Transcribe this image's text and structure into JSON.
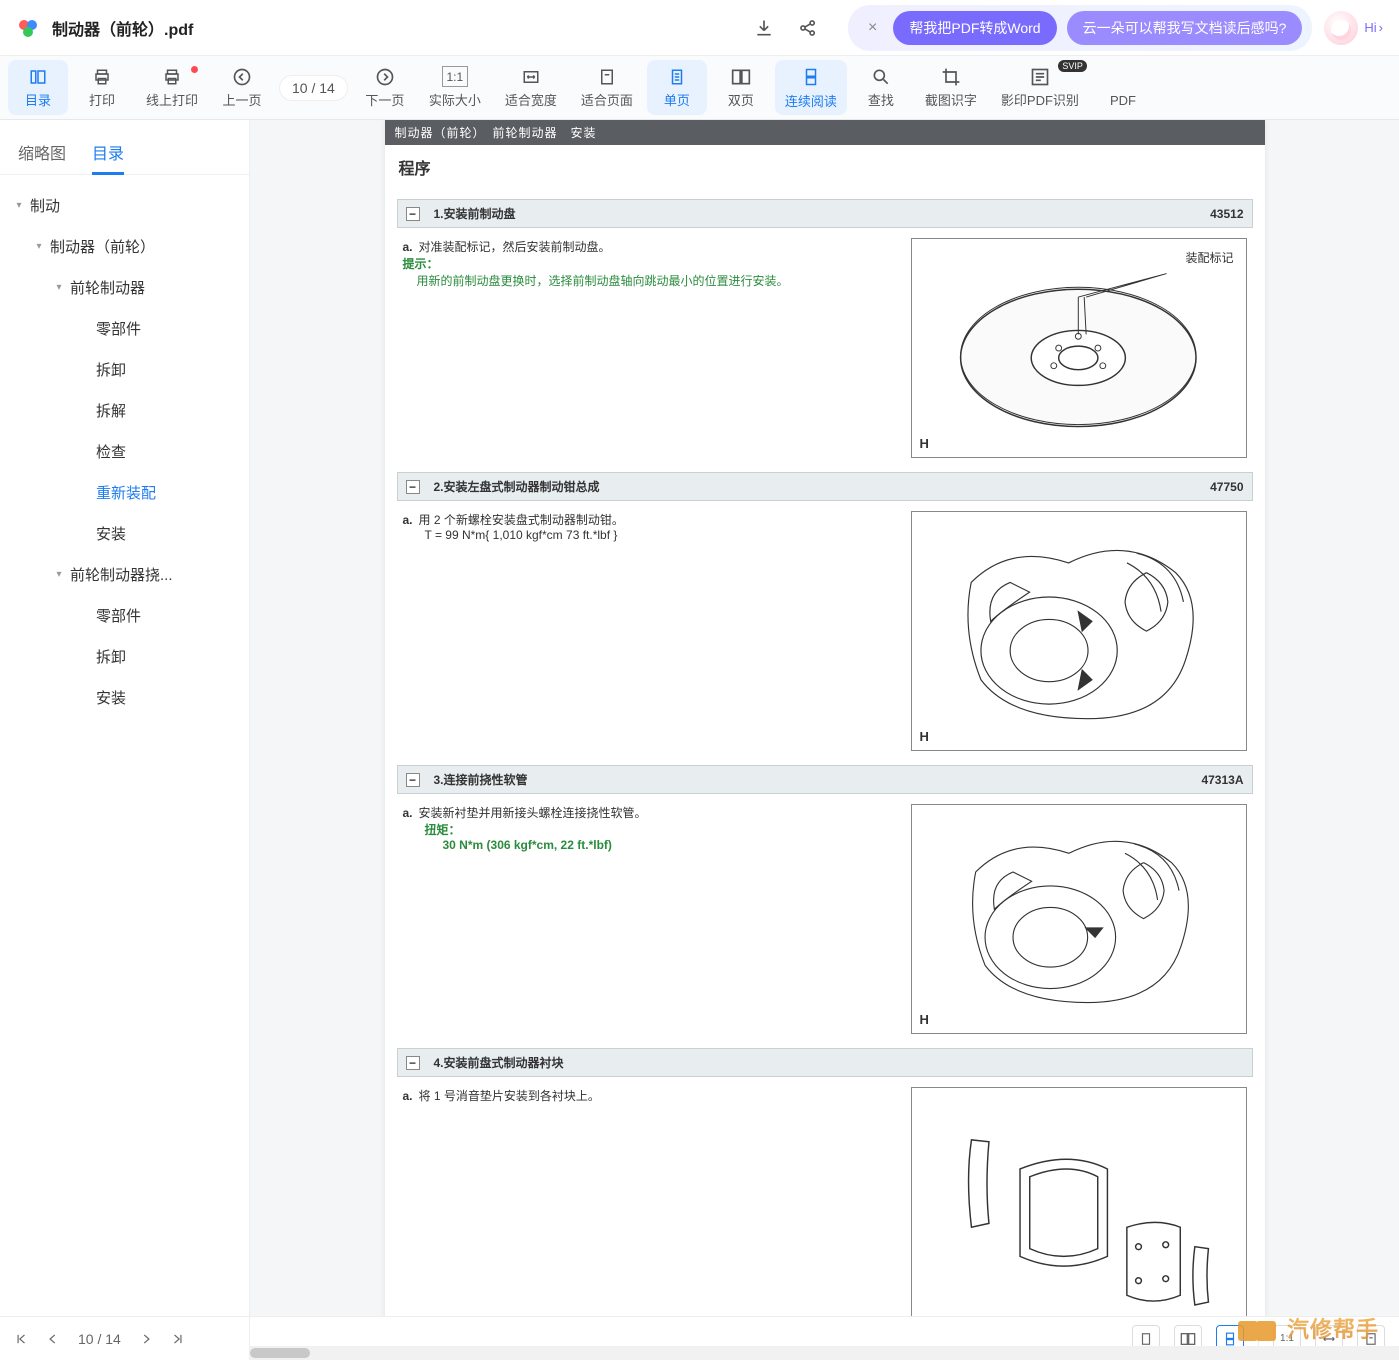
{
  "titlebar": {
    "doc_name": "制动器（前轮）.pdf",
    "promo_close": "×",
    "promo1": "帮我把PDF转成Word",
    "promo2": "云一朵可以帮我写文档读后感吗?",
    "hi": "Hi"
  },
  "toolbar": {
    "items": [
      {
        "label": "目录",
        "active": true
      },
      {
        "label": "打印"
      },
      {
        "label": "线上打印",
        "dot": true
      },
      {
        "label": "上一页"
      },
      {
        "label": "下一页"
      },
      {
        "label": "实际大小"
      },
      {
        "label": "适合宽度"
      },
      {
        "label": "适合页面"
      },
      {
        "label": "单页",
        "active": true
      },
      {
        "label": "双页"
      },
      {
        "label": "连续阅读",
        "active": true
      },
      {
        "label": "查找"
      },
      {
        "label": "截图识字"
      },
      {
        "label": "影印PDF识别",
        "badge": "SVIP"
      },
      {
        "label": "PDF"
      }
    ],
    "page_current": "10",
    "page_sep": "/",
    "page_total": "14"
  },
  "sidebar": {
    "tabs": [
      "缩略图",
      "目录"
    ],
    "tree": [
      {
        "label": "制动",
        "level": 0,
        "arrow": true
      },
      {
        "label": "制动器（前轮）",
        "level": 1,
        "arrow": true
      },
      {
        "label": "前轮制动器",
        "level": 2,
        "arrow": true
      },
      {
        "label": "零部件",
        "level": 3
      },
      {
        "label": "拆卸",
        "level": 3
      },
      {
        "label": "拆解",
        "level": 3
      },
      {
        "label": "检查",
        "level": 3
      },
      {
        "label": "重新装配",
        "level": 3,
        "active": true
      },
      {
        "label": "安装",
        "level": 3
      },
      {
        "label": "前轮制动器挠...",
        "level": 2,
        "arrow": true
      },
      {
        "label": "零部件",
        "level": 3
      },
      {
        "label": "拆卸",
        "level": 3
      },
      {
        "label": "安装",
        "level": 3
      }
    ],
    "footer": {
      "page_current": "10",
      "sep": "/",
      "total": "14"
    }
  },
  "doc": {
    "header_bar": "制动器（前轮）　前轮制动器　安装",
    "procedure_title": "程序",
    "steps": [
      {
        "num": "1.",
        "title": "安装前制动盘",
        "code": "43512",
        "point_label": "a.",
        "point_text": "对准装配标记，然后安装前制动盘。",
        "hint_label": "提示：",
        "hint_text": "用新的前制动盘更换时，选择前制动盘轴向跳动最小的位置进行安装。",
        "fig_letter": "H",
        "fig_annot": "装配标记"
      },
      {
        "num": "2.",
        "title": "安装左盘式制动器制动钳总成",
        "code": "47750",
        "point_label": "a.",
        "point_text": "用 2 个新螺栓安装盘式制动器制动钳。",
        "torque_text": "T = 99 N*m{ 1,010 kgf*cm 73 ft.*lbf }",
        "fig_letter": "H"
      },
      {
        "num": "3.",
        "title": "连接前挠性软管",
        "code": "47313A",
        "point_label": "a.",
        "point_text": "安装新衬垫并用新接头螺栓连接挠性软管。",
        "torque_label": "扭矩：",
        "torque_val": "30 N*m (306 kgf*cm, 22 ft.*lbf)",
        "fig_letter": "H"
      },
      {
        "num": "4.",
        "title": "安装前盘式制动器衬块",
        "code": "",
        "point_label": "a.",
        "point_text": "将 1 号消音垫片安装到各衬块上。"
      }
    ]
  },
  "statusbar": {
    "icons": [
      "single",
      "double",
      "continuous",
      "fit",
      "1:1",
      "width",
      "page"
    ]
  },
  "watermark": "汽修帮手"
}
